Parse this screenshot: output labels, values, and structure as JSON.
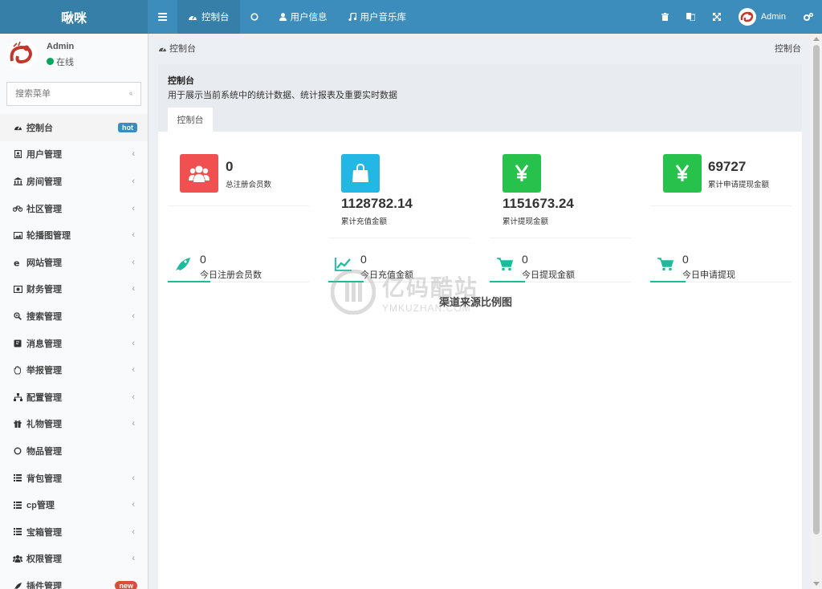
{
  "app": {
    "logo": "啾咪"
  },
  "topnav": [
    {
      "label": "",
      "icon": "menu-icon"
    },
    {
      "label": "控制台",
      "icon": "dashboard-icon",
      "active": true
    },
    {
      "label": "",
      "icon": "circle-icon"
    },
    {
      "label": "用户信息",
      "icon": "user-icon"
    },
    {
      "label": "用户音乐库",
      "icon": "music-icon"
    }
  ],
  "topright": {
    "admin_label": "Admin"
  },
  "user": {
    "name": "Admin",
    "status": "在线"
  },
  "search": {
    "placeholder": "搜索菜单"
  },
  "menu": [
    {
      "label": "控制台",
      "icon": "dashboard-icon",
      "badge": "hot",
      "active": true
    },
    {
      "label": "用户管理",
      "icon": "id-card-icon"
    },
    {
      "label": "房间管理",
      "icon": "bank-icon"
    },
    {
      "label": "社区管理",
      "icon": "bicycle-icon"
    },
    {
      "label": "轮播图管理",
      "icon": "image-icon"
    },
    {
      "label": "网站管理",
      "icon": "ie-icon"
    },
    {
      "label": "财务管理",
      "icon": "money-icon"
    },
    {
      "label": "搜索管理",
      "icon": "search-plus-icon"
    },
    {
      "label": "消息管理",
      "icon": "message-icon"
    },
    {
      "label": "举报管理",
      "icon": "hand-icon"
    },
    {
      "label": "配置管理",
      "icon": "sitemap-icon"
    },
    {
      "label": "礼物管理",
      "icon": "gift-icon"
    },
    {
      "label": "物品管理",
      "icon": "circle-icon"
    },
    {
      "label": "背包管理",
      "icon": "list-icon"
    },
    {
      "label": "cp管理",
      "icon": "list-icon"
    },
    {
      "label": "宝箱管理",
      "icon": "list-icon"
    },
    {
      "label": "权限管理",
      "icon": "group-icon"
    },
    {
      "label": "插件管理",
      "icon": "rocket-icon",
      "badge": "new"
    }
  ],
  "breadcrumb": {
    "left": "控制台",
    "right": "控制台"
  },
  "panel": {
    "title": "控制台",
    "desc": "用于展示当前系统中的统计数据、统计报表及重要实时数据",
    "tab": "控制台"
  },
  "stats": [
    {
      "value": "0",
      "label": "总注册会员数",
      "color": "#f05050",
      "icon": "users-icon"
    },
    {
      "value": "1128782.14",
      "label": "累计充值金额",
      "color": "#23b7e5",
      "icon": "shopping-bag-icon"
    },
    {
      "value": "1151673.24",
      "label": "累计提现金额",
      "color": "#27c24c",
      "icon": "yen-icon"
    },
    {
      "value": "69727",
      "label": "累计申请提现金额",
      "color": "#27c24c",
      "icon": "yen-icon"
    }
  ],
  "minis": [
    {
      "value": "0",
      "label": "今日注册会员数",
      "icon": "rocket-icon"
    },
    {
      "value": "0",
      "label": "今日充值金额",
      "icon": "line-chart-icon"
    },
    {
      "value": "0",
      "label": "今日提现金额",
      "icon": "cart-icon"
    },
    {
      "value": "0",
      "label": "今日申请提现",
      "icon": "cart-icon"
    }
  ],
  "chart": {
    "title": "渠道来源比例图"
  },
  "watermark": {
    "line1": "亿码酷站",
    "line2": "YMKUZHAN.COM"
  }
}
